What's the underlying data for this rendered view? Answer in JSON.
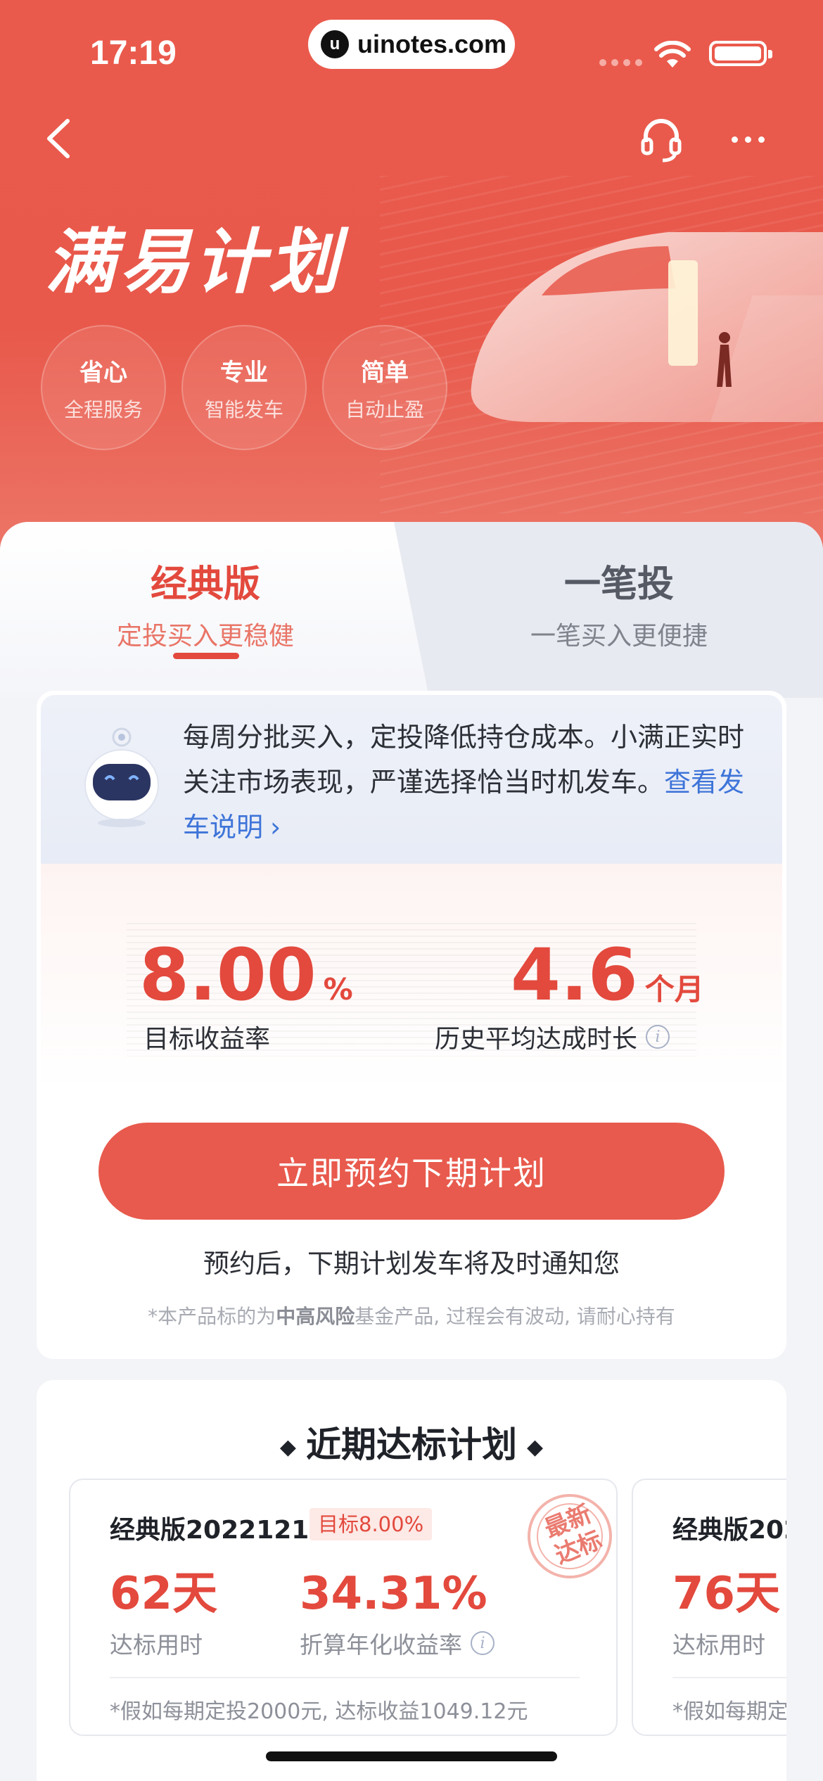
{
  "status_bar": {
    "time": "17:19",
    "url": "uinotes.com"
  },
  "hero": {
    "title": "满易计划",
    "features": [
      {
        "title": "省心",
        "subtitle": "全程服务"
      },
      {
        "title": "专业",
        "subtitle": "智能发车"
      },
      {
        "title": "简单",
        "subtitle": "自动止盈"
      }
    ]
  },
  "tabs": [
    {
      "title": "经典版",
      "subtitle": "定投买入更稳健",
      "active": true
    },
    {
      "title": "一笔投",
      "subtitle": "一笔买入更便捷",
      "active": false
    }
  ],
  "intro": {
    "text": "每周分批买入，定投降低持仓成本。小满正实时关注市场表现，严谨选择恰当时机发车。",
    "link": "查看发车说明"
  },
  "stats": {
    "target_rate": {
      "value": "8.00",
      "unit": "%",
      "label": "目标收益率"
    },
    "avg_duration": {
      "value": "4.6",
      "unit": "个月",
      "label": "历史平均达成时长"
    }
  },
  "cta": {
    "label": "立即预约下期计划",
    "note": "预约后，下期计划发车将及时通知您",
    "disclaimer_prefix": "*本产品标的为",
    "disclaimer_bold": "中高风险",
    "disclaimer_suffix": "基金产品, 过程会有波动, 请耐心持有"
  },
  "recent": {
    "title": "近期达标计划",
    "plans": [
      {
        "name": "经典版20221216",
        "badge": "目标8.00%",
        "days": "62天",
        "days_label": "达标用时",
        "rate": "34.31%",
        "rate_label": "折算年化收益率",
        "footnote": "*假如每期定投2000元, 达标收益1049.12元",
        "stamp": "最新达标"
      },
      {
        "name": "经典版202",
        "days": "76天",
        "days_label": "达标用时",
        "footnote": "*假如每期定"
      }
    ]
  },
  "colors": {
    "brand": "#e85a4d",
    "accent_text": "#e3493d",
    "link": "#3e74d9"
  },
  "icons": [
    "back-icon",
    "headset-icon",
    "more-icon",
    "robot-icon",
    "info-icon",
    "chevron-right-icon"
  ]
}
